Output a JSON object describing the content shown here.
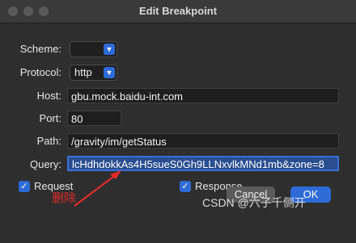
{
  "window": {
    "title": "Edit Breakpoint"
  },
  "form": {
    "scheme": {
      "label": "Scheme:",
      "value": ""
    },
    "protocol": {
      "label": "Protocol:",
      "value": "http"
    },
    "host": {
      "label": "Host:",
      "value": "gbu.mock.baidu-int.com"
    },
    "port": {
      "label": "Port:",
      "value": "80"
    },
    "path": {
      "label": "Path:",
      "value": "/gravity/im/getStatus"
    },
    "query": {
      "label": "Query:",
      "value": "lcHdhdokkAs4H5sueS0Gh9LLNxvlkMNd1mb&zone=8"
    }
  },
  "options": {
    "request": {
      "label": "Request",
      "checked": true
    },
    "response": {
      "label": "Response",
      "checked": true
    }
  },
  "annotation": {
    "text": "删除",
    "color": "#e02a2a"
  },
  "buttons": {
    "cancel": "Cancel",
    "ok": "OK"
  },
  "watermark": "CSDN @六子千侧开",
  "colors": {
    "accent": "#2f6bd7",
    "background": "#2e2e2e",
    "annotation": "#e02a2a"
  },
  "icons": {
    "select_arrow": "chevron-down-icon",
    "check": "checkmark-icon"
  }
}
